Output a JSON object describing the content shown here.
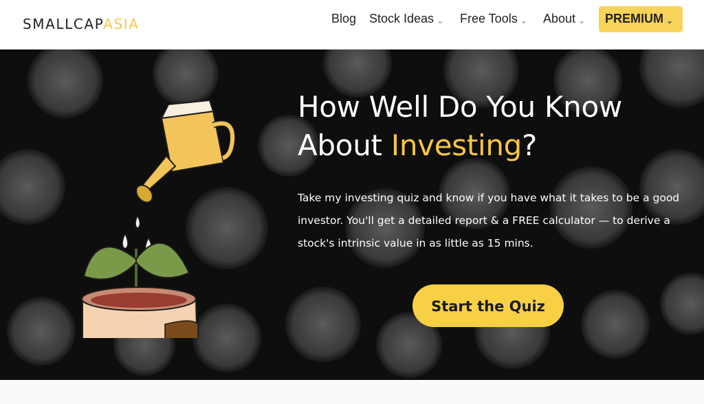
{
  "brand": {
    "name_part1": "SMALLCAP",
    "name_part2": "ASIA"
  },
  "nav": {
    "items": [
      {
        "label": "Blog",
        "has_dropdown": false
      },
      {
        "label": "Stock Ideas",
        "has_dropdown": true
      },
      {
        "label": "Free Tools",
        "has_dropdown": true
      },
      {
        "label": "About",
        "has_dropdown": true
      }
    ],
    "premium_label": "PREMIUM",
    "dropdown_glyph": "⌄"
  },
  "hero": {
    "headline_part1": "How Well Do You Know",
    "headline_part2": "About ",
    "headline_highlight": "Investing",
    "headline_part3": "?",
    "description": "Take my investing quiz and know if you have what it takes to be a good investor. You'll get a detailed report & a FREE calculator — to derive a stock's intrinsic value in as little as 15 mins.",
    "cta_label": "Start the Quiz"
  },
  "colors": {
    "accent": "#f6c644",
    "button": "#f7d044",
    "hero_bg": "#0e0e0e",
    "header_bg": "#ffffff"
  },
  "icons": {
    "illustration": "watering-can-plant-head-illustration",
    "nav_dropdown": "chevron-down-icon"
  }
}
